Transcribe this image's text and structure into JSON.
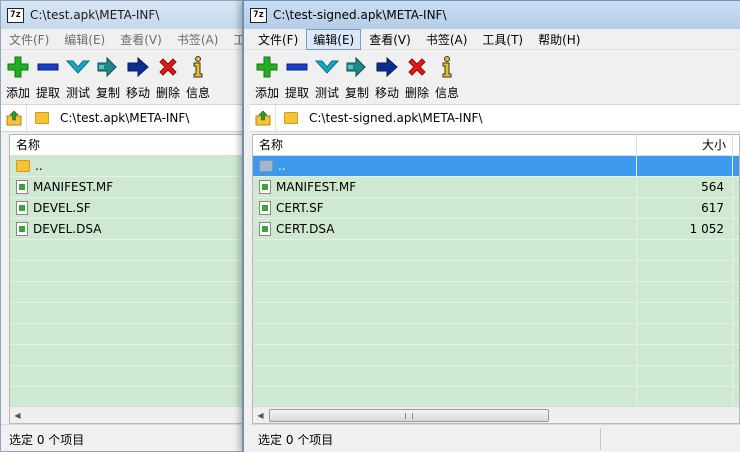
{
  "left_window": {
    "title": "C:\\test.apk\\META-INF\\",
    "menu": [
      "文件(F)",
      "编辑(E)",
      "查看(V)",
      "书签(A)",
      "工"
    ],
    "toolbar": [
      "添加",
      "提取",
      "测试",
      "复制",
      "移动",
      "删除",
      "信息"
    ],
    "address": "C:\\test.apk\\META-INF\\",
    "columns": {
      "name": "名称"
    },
    "files": [
      {
        "name": ".."
      },
      {
        "name": "MANIFEST.MF"
      },
      {
        "name": "DEVEL.SF"
      },
      {
        "name": "DEVEL.DSA"
      }
    ],
    "status": "选定 0 个项目"
  },
  "right_window": {
    "title": "C:\\test-signed.apk\\META-INF\\",
    "menu": [
      "文件(F)",
      "编辑(E)",
      "查看(V)",
      "书签(A)",
      "工具(T)",
      "帮助(H)"
    ],
    "active_menu": "编辑(E)",
    "toolbar": [
      "添加",
      "提取",
      "测试",
      "复制",
      "移动",
      "删除",
      "信息"
    ],
    "address": "C:\\test-signed.apk\\META-INF\\",
    "columns": {
      "name": "名称",
      "size": "大小"
    },
    "files": [
      {
        "name": "..",
        "size": ""
      },
      {
        "name": "MANIFEST.MF",
        "size": "564"
      },
      {
        "name": "CERT.SF",
        "size": "617"
      },
      {
        "name": "CERT.DSA",
        "size": "1 052"
      }
    ],
    "status": "选定 0 个项目"
  },
  "app_icon_label": "7z",
  "colors": {
    "list_background": "#cfe8d0",
    "selection": "#3d99ec",
    "add_icon": "#22b022",
    "extract_icon": "#1a3fcc",
    "test_icon": "#17a9c4",
    "copy_icon": "#1d8a8a",
    "move_icon": "#0d2d8f",
    "delete_icon": "#e01919",
    "info_icon": "#e8c21c"
  },
  "icons": {
    "add": "plus-icon",
    "extract": "minus-icon",
    "test": "check-chevron-icon",
    "copy": "double-arrow-icon",
    "move": "arrow-right-icon",
    "delete": "x-icon",
    "info": "info-icon"
  }
}
